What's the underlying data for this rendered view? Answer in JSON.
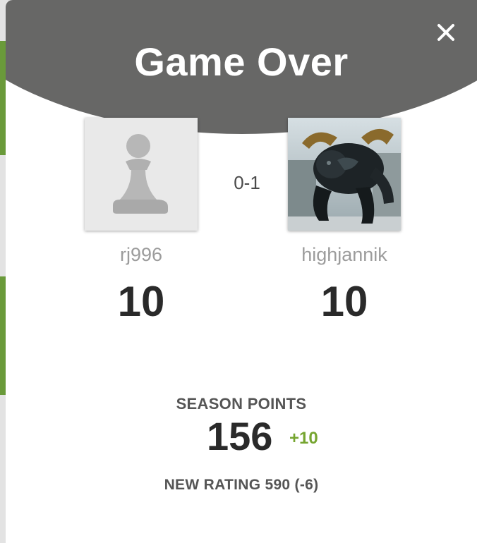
{
  "modal": {
    "title": "Game Over",
    "close_icon": "close-icon"
  },
  "result": {
    "score": "0-1"
  },
  "players": [
    {
      "username": "rj996",
      "points": "10",
      "avatar": "pawn-avatar-icon"
    },
    {
      "username": "highjannik",
      "points": "10",
      "avatar": "bull-photo-avatar"
    }
  ],
  "season": {
    "label": "SEASON POINTS",
    "value": "156",
    "delta": "+10"
  },
  "rating": {
    "text": "NEW RATING 590 (-6)"
  },
  "colors": {
    "header_bg": "#676766",
    "delta_green": "#76a530",
    "page_bg": "#ffffff"
  }
}
